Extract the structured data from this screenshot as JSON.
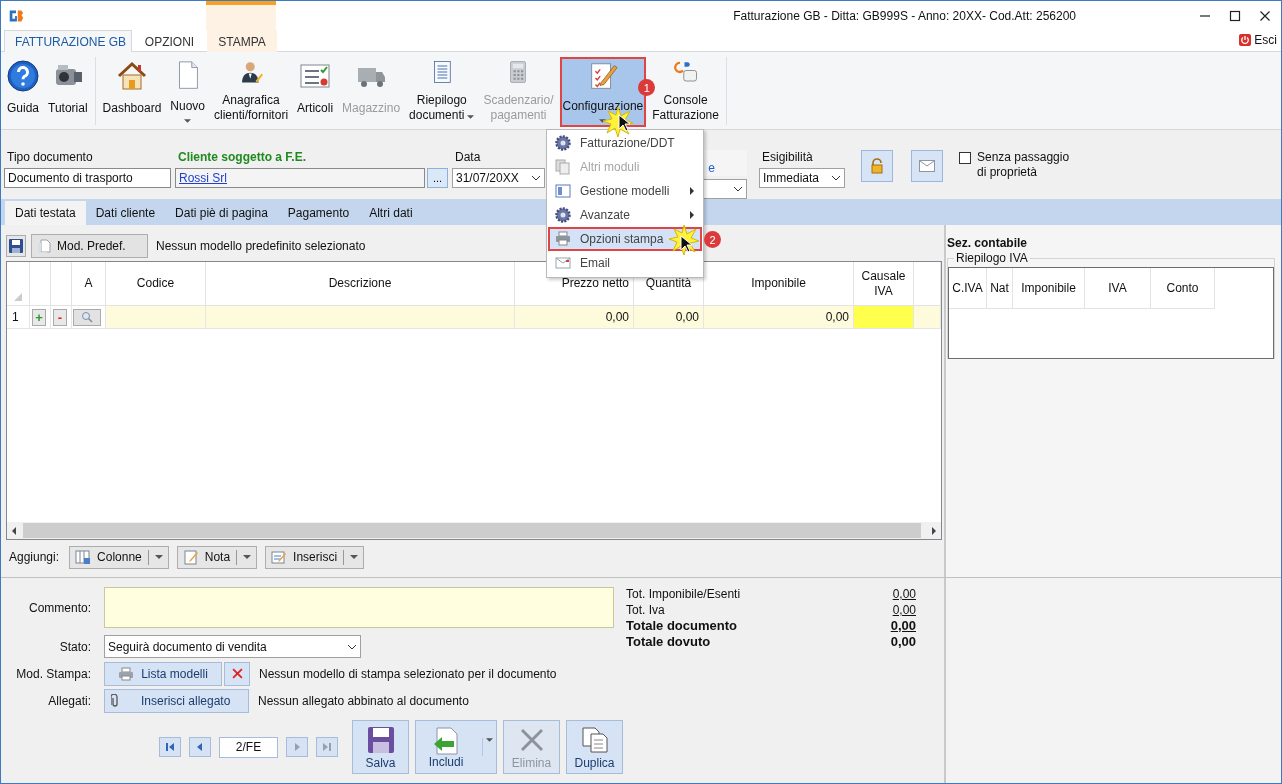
{
  "window": {
    "title": "Fatturazione GB - Ditta: GB999S - Anno: 20XX- Cod.Att: 256200"
  },
  "ribbon_tabs": [
    {
      "label": "FATTURAZIONE GB",
      "selected": true,
      "contextual": false
    },
    {
      "label": "OPZIONI",
      "selected": false,
      "contextual": false
    },
    {
      "label": "STAMPA",
      "selected": false,
      "contextual": true
    }
  ],
  "exit": "Esci",
  "ribbon_groups": [
    [
      {
        "kind": "help",
        "lines": [
          "Guida"
        ],
        "disabled": false,
        "dropdown": false,
        "highlighted": false
      },
      {
        "kind": "camera",
        "lines": [
          "Tutorial"
        ],
        "disabled": false,
        "dropdown": false,
        "highlighted": false
      }
    ],
    [
      {
        "kind": "house",
        "lines": [
          "Dashboard"
        ],
        "disabled": false,
        "dropdown": false,
        "highlighted": false
      },
      {
        "kind": "page",
        "lines": [
          "Nuovo"
        ],
        "disabled": false,
        "dropdown": true,
        "highlighted": false
      },
      {
        "kind": "person",
        "lines": [
          "Anagrafica",
          "clienti/fornitori"
        ],
        "disabled": false,
        "dropdown": false,
        "highlighted": false
      },
      {
        "kind": "checklist",
        "lines": [
          "Articoli"
        ],
        "disabled": false,
        "dropdown": false,
        "highlighted": false
      },
      {
        "kind": "truck",
        "lines": [
          "Magazzino"
        ],
        "disabled": true,
        "dropdown": false,
        "highlighted": false
      },
      {
        "kind": "list",
        "lines": [
          "Riepilogo",
          "documenti"
        ],
        "disabled": false,
        "dropdown": true,
        "highlighted": false
      },
      {
        "kind": "calculator",
        "lines": [
          "Scadenzario/",
          "pagamenti"
        ],
        "disabled": true,
        "dropdown": false,
        "highlighted": false
      },
      {
        "kind": "edit",
        "lines": [
          "Configurazione"
        ],
        "disabled": false,
        "dropdown": true,
        "highlighted": true,
        "badge": "1"
      },
      {
        "kind": "sdi",
        "lines": [
          "Console",
          "Fatturazione"
        ],
        "disabled": false,
        "dropdown": false,
        "highlighted": false
      }
    ]
  ],
  "menu": [
    {
      "kind": "gear",
      "label": "Fatturazione/DDT",
      "disabled": false,
      "submenu": false,
      "highlighted": false
    },
    {
      "kind": "pages",
      "label": "Altri moduli",
      "disabled": true,
      "submenu": false,
      "highlighted": false
    },
    {
      "kind": "panel",
      "label": "Gestione modelli",
      "disabled": false,
      "submenu": true,
      "highlighted": false
    },
    {
      "kind": "gear",
      "label": "Avanzate",
      "disabled": false,
      "submenu": true,
      "highlighted": false
    },
    {
      "kind": "printer",
      "label": "Opzioni stampa",
      "disabled": false,
      "submenu": false,
      "highlighted": true,
      "badge": "2"
    },
    {
      "kind": "mail",
      "label": "Email",
      "disabled": false,
      "submenu": false,
      "highlighted": false
    }
  ],
  "header": {
    "tipo_documento": {
      "label": "Tipo documento",
      "value": "Documento di trasporto"
    },
    "cliente": {
      "label": "Cliente soggetto a F.E.",
      "value": "Rossi Srl",
      "button": "..."
    },
    "data": {
      "label": "Data",
      "value": "31/07/20XX"
    },
    "field_4": {
      "label": "e"
    },
    "esigibilita": {
      "label": "Esigibilità",
      "value": "Immediata"
    },
    "senza_passaggio": {
      "label": "Senza passaggio di proprietà",
      "checked": false
    }
  },
  "doc_tabs": [
    {
      "label": "Dati testata",
      "selected": true
    },
    {
      "label": "Dati cliente",
      "selected": false
    },
    {
      "label": "Dati piè di pagina",
      "selected": false
    },
    {
      "label": "Pagamento",
      "selected": false
    },
    {
      "label": "Altri dati",
      "selected": false
    }
  ],
  "model_bar": {
    "button": "Mod. Predef.",
    "text": "Nessun modello predefinito selezionato"
  },
  "table": {
    "columns": [
      "A",
      "Codice",
      "Descrizione",
      "Prezzo netto",
      "Quantità",
      "Imponibile",
      "Causale IVA"
    ],
    "rows": [
      {
        "num": "1",
        "add": "+",
        "remove": "-",
        "prezzo_netto": "0,00",
        "quantita": "0,00",
        "imponibile": "0,00"
      }
    ]
  },
  "add_bar": {
    "label": "Aggiungi:",
    "buttons": [
      {
        "kind": "columns",
        "label": "Colonne"
      },
      {
        "kind": "note",
        "label": "Nota"
      },
      {
        "kind": "insert",
        "label": "Inserisci"
      }
    ]
  },
  "form": {
    "commento_label": "Commento:",
    "stato_label": "Stato:",
    "stato": "Seguirà documento di vendita",
    "mod_stampa_label": "Mod. Stampa:",
    "lista_modelli": "Lista modelli",
    "mod_stampa_text": "Nessun modello di stampa selezionato per il documento",
    "allegati_label": "Allegati:",
    "inserisci_allegato": "Inserisci allegato",
    "allegati_text": "Nessun allegato abbinato al documento"
  },
  "navigator": {
    "value": "2/FE"
  },
  "actions": [
    {
      "kind": "save",
      "label": "Salva",
      "disabled": false,
      "split": false
    },
    {
      "kind": "include",
      "label": "Includi",
      "disabled": false,
      "split": true
    },
    {
      "kind": "delete",
      "label": "Elimina",
      "disabled": true,
      "split": false
    },
    {
      "kind": "copy",
      "label": "Duplica",
      "disabled": false,
      "split": false
    }
  ],
  "totals": [
    {
      "label": "Tot. Imponibile/Esenti",
      "value": "0,00",
      "bold": false,
      "underline": true
    },
    {
      "label": "Tot. Iva",
      "value": "0,00",
      "bold": false,
      "underline": true
    },
    {
      "label": "Totale documento",
      "value": "0,00",
      "bold": true,
      "underline": true
    },
    {
      "label": "Totale dovuto",
      "value": "0,00",
      "bold": true,
      "underline": false
    }
  ],
  "sez_contabile": {
    "title": "Sez. contabile",
    "group": "Riepilogo IVA",
    "columns": [
      "C.IVA",
      "Nat",
      "Imponibile",
      "IVA",
      "Conto"
    ]
  }
}
